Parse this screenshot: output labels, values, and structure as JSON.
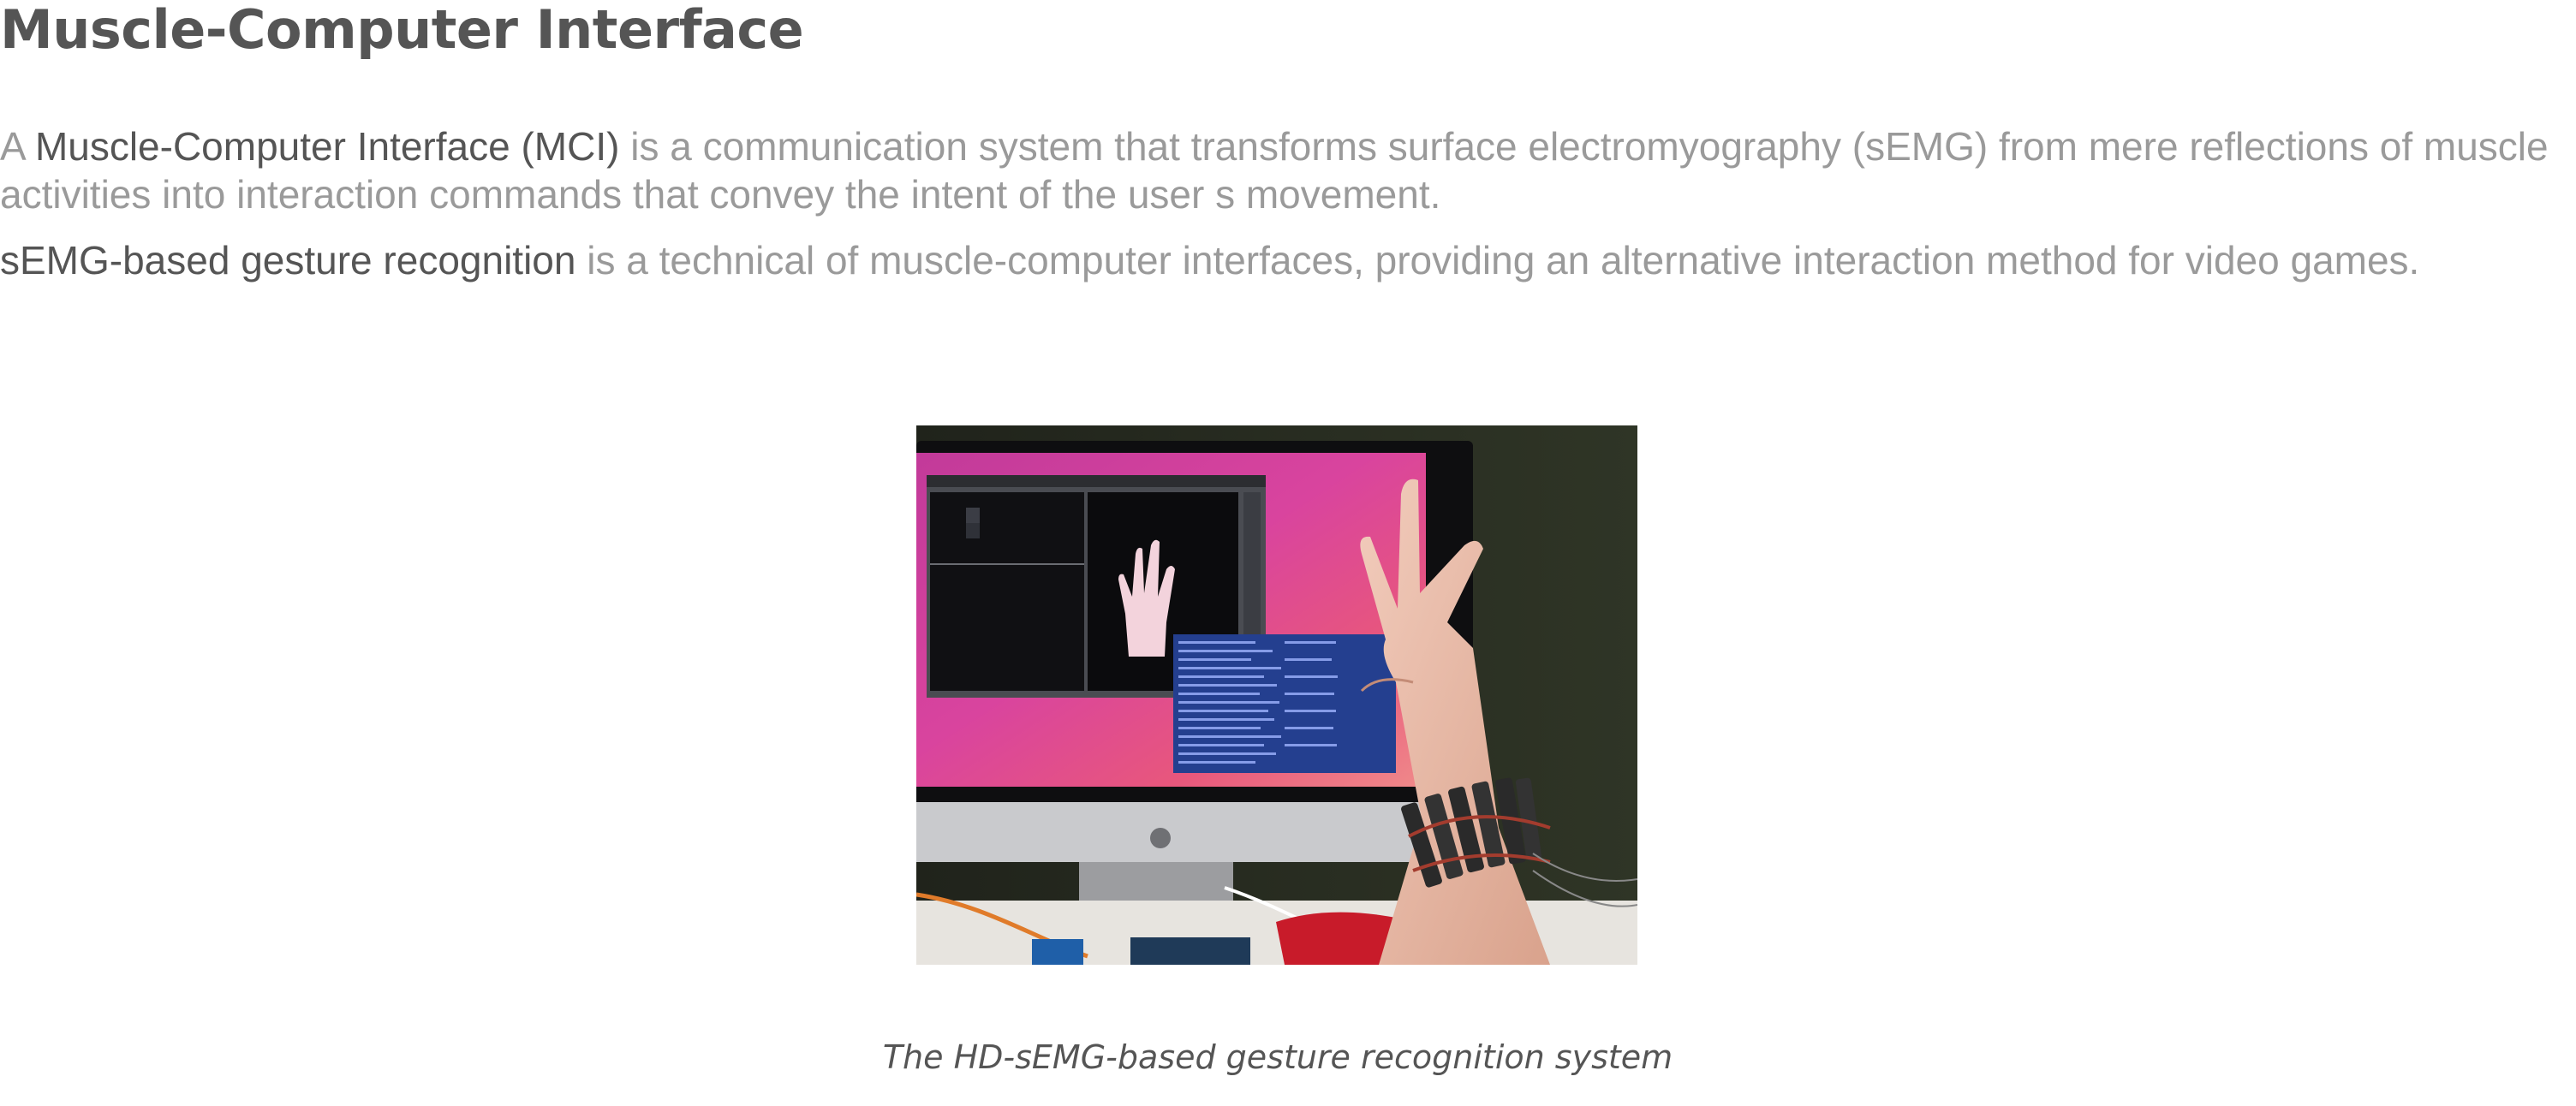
{
  "title": "Muscle-Computer Interface",
  "paragraph1": {
    "prefix": "A ",
    "term": "Muscle-Computer Interface (MCI)",
    "text": " is a communication system that transforms surface electromyography (sEMG)  from mere reflections of muscle activities into interaction commands that convey the intent of the user s movement."
  },
  "paragraph2": {
    "term": "sEMG-based gesture recognition",
    "text": " is a technical of muscle-computer interfaces, providing an alternative interaction method for video games."
  },
  "figure": {
    "caption": "The HD-sEMG-based gesture recognition system"
  },
  "colors": {
    "heading": "#555555",
    "body_text": "#9a9a9a"
  }
}
